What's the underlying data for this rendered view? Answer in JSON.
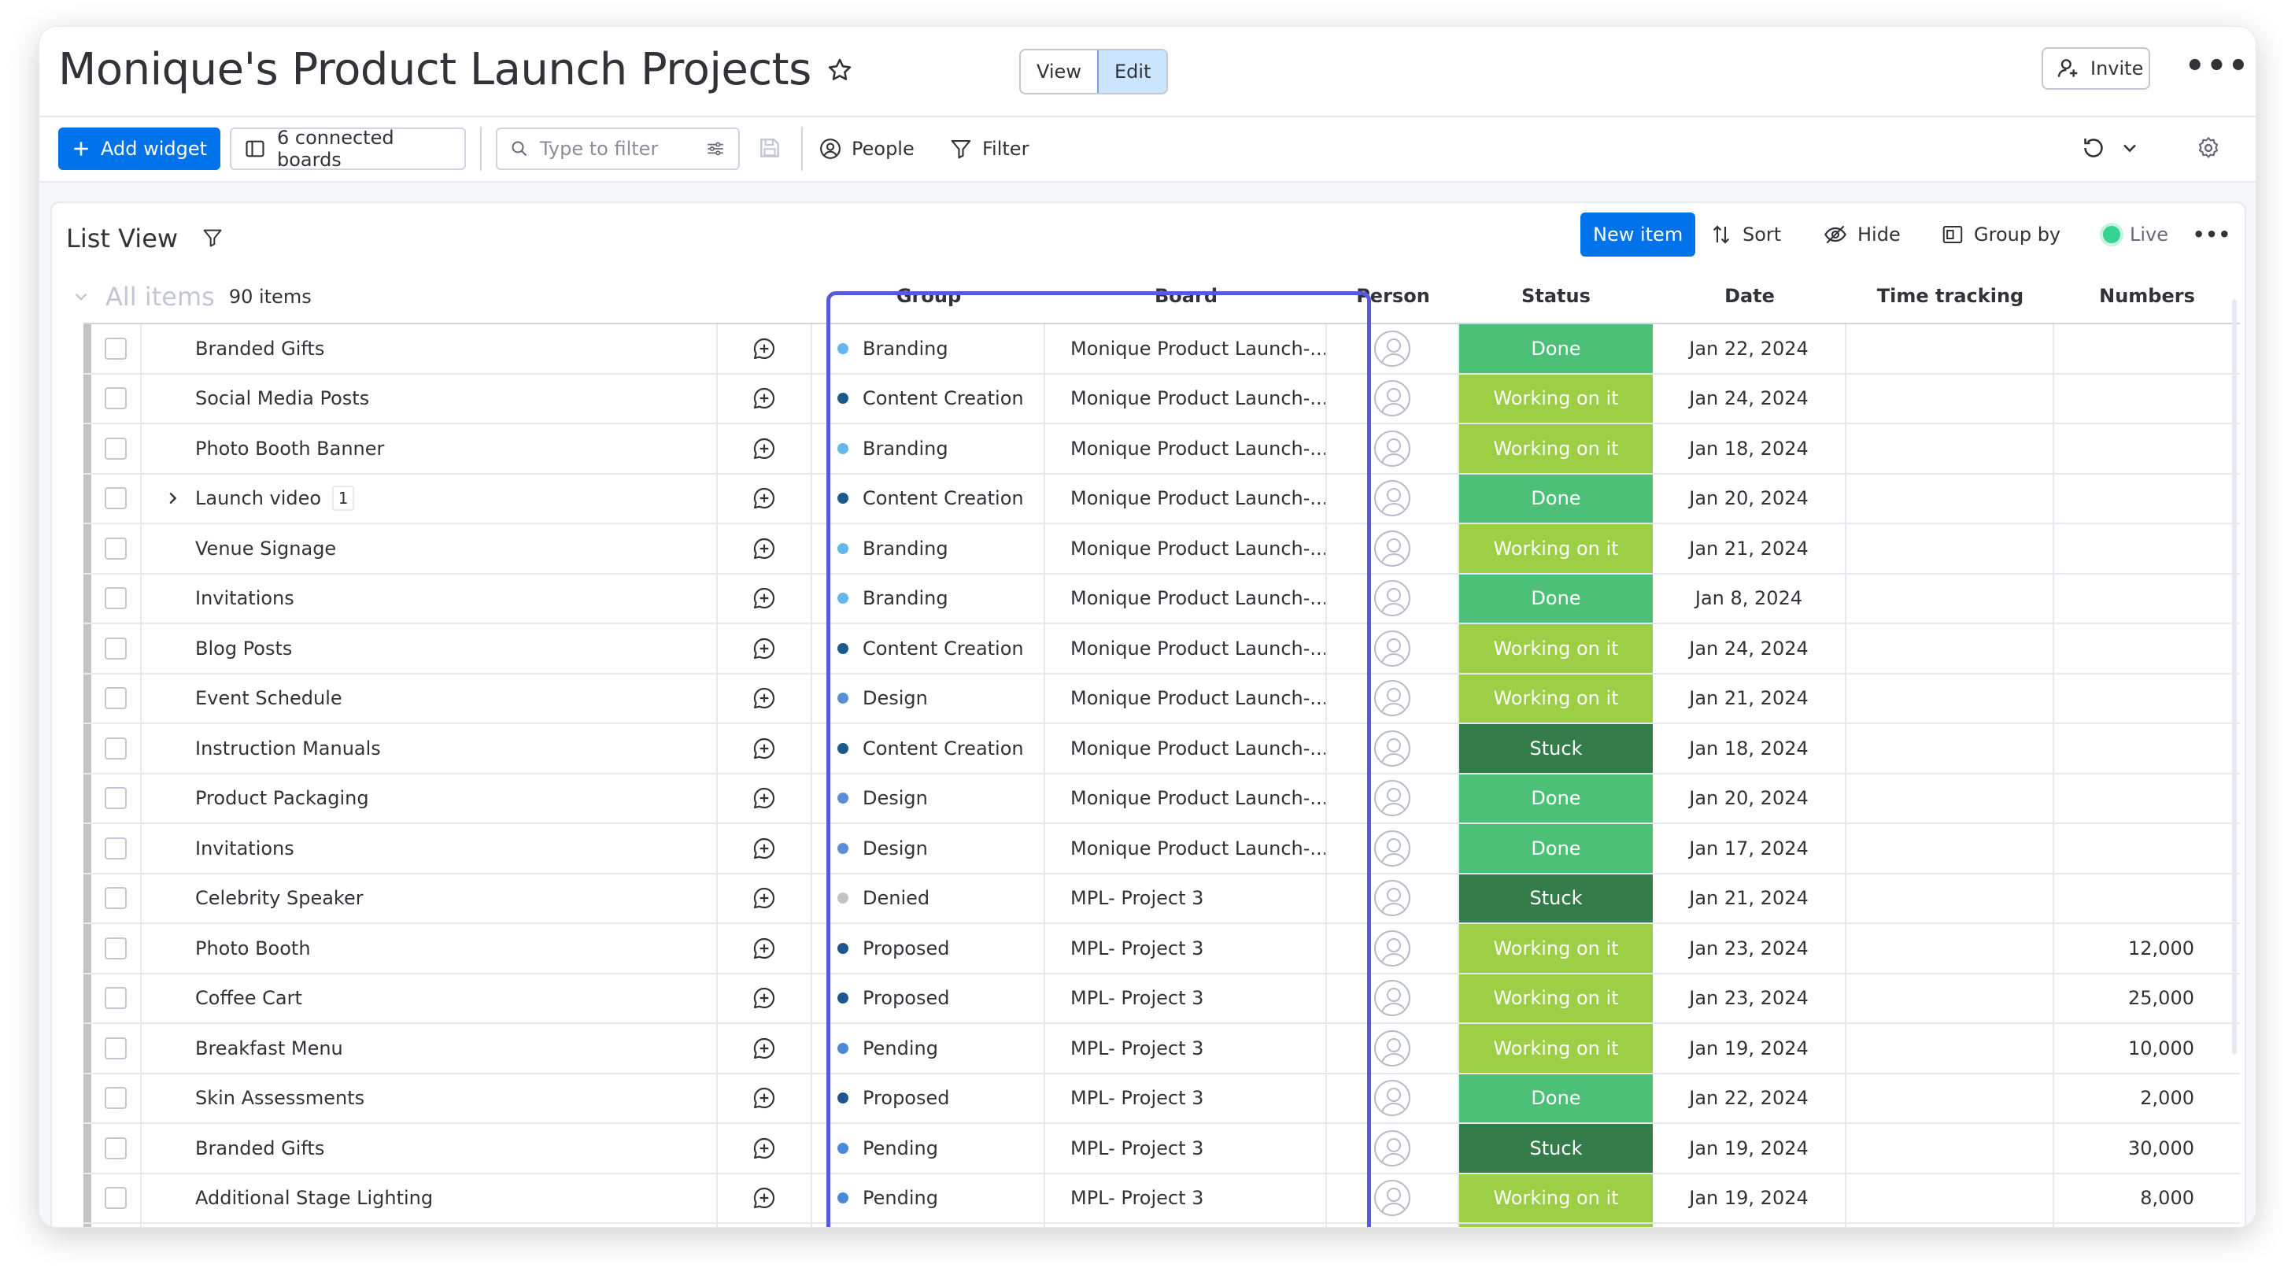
{
  "header": {
    "title": "Monique's Product Launch Projects",
    "view_label": "View",
    "edit_label": "Edit",
    "invite_label": "Invite"
  },
  "toolbar": {
    "add_widget_label": "Add widget",
    "connected_boards_label": "6 connected boards",
    "filter_placeholder": "Type to filter",
    "people_label": "People",
    "filter_label": "Filter"
  },
  "list_view": {
    "title": "List View",
    "new_item_label": "New item",
    "sort_label": "Sort",
    "hide_label": "Hide",
    "group_by_label": "Group by",
    "live_label": "Live",
    "all_items_label": "All items",
    "items_count": "90 items"
  },
  "columns": {
    "group": "Group",
    "board": "Board",
    "person": "Person",
    "status": "Status",
    "date": "Date",
    "time_tracking": "Time tracking",
    "numbers": "Numbers"
  },
  "colors": {
    "accent": "#0073ea",
    "highlight": "#5959e0",
    "status_done": "#4cc076",
    "status_working": "#9ccf45",
    "status_stuck": "#347d4a",
    "group_branding": "#66b8ec",
    "group_content_creation": "#1d5a8c",
    "group_design": "#5a8fd8",
    "group_denied": "#c4c4c4",
    "group_proposed": "#1e5790",
    "group_pending": "#4b89dc"
  },
  "rows": [
    {
      "name": "Branded Gifts",
      "group": "Branding",
      "group_color": "#66b8ec",
      "board": "Monique Product Launch-...",
      "status": "Done",
      "status_color": "#4cc076",
      "date": "Jan 22, 2024",
      "number": ""
    },
    {
      "name": "Social Media Posts",
      "group": "Content Creation",
      "group_color": "#1d5a8c",
      "board": "Monique Product Launch-...",
      "status": "Working on it",
      "status_color": "#9ccf45",
      "date": "Jan 24, 2024",
      "number": ""
    },
    {
      "name": "Photo Booth Banner",
      "group": "Branding",
      "group_color": "#66b8ec",
      "board": "Monique Product Launch-...",
      "status": "Working on it",
      "status_color": "#9ccf45",
      "date": "Jan 18, 2024",
      "number": ""
    },
    {
      "name": "Launch video",
      "subitems": "1",
      "group": "Content Creation",
      "group_color": "#1d5a8c",
      "board": "Monique Product Launch-...",
      "status": "Done",
      "status_color": "#4cc076",
      "date": "Jan 20, 2024",
      "number": ""
    },
    {
      "name": "Venue Signage",
      "group": "Branding",
      "group_color": "#66b8ec",
      "board": "Monique Product Launch-...",
      "status": "Working on it",
      "status_color": "#9ccf45",
      "date": "Jan 21, 2024",
      "number": ""
    },
    {
      "name": "Invitations",
      "group": "Branding",
      "group_color": "#66b8ec",
      "board": "Monique Product Launch-...",
      "status": "Done",
      "status_color": "#4cc076",
      "date": "Jan 8, 2024",
      "number": ""
    },
    {
      "name": "Blog Posts",
      "group": "Content Creation",
      "group_color": "#1d5a8c",
      "board": "Monique Product Launch-...",
      "status": "Working on it",
      "status_color": "#9ccf45",
      "date": "Jan 24, 2024",
      "number": ""
    },
    {
      "name": "Event Schedule",
      "group": "Design",
      "group_color": "#5a8fd8",
      "board": "Monique Product Launch-...",
      "status": "Working on it",
      "status_color": "#9ccf45",
      "date": "Jan 21, 2024",
      "number": ""
    },
    {
      "name": "Instruction Manuals",
      "group": "Content Creation",
      "group_color": "#1d5a8c",
      "board": "Monique Product Launch-...",
      "status": "Stuck",
      "status_color": "#347d4a",
      "date": "Jan 18, 2024",
      "number": ""
    },
    {
      "name": "Product Packaging",
      "group": "Design",
      "group_color": "#5a8fd8",
      "board": "Monique Product Launch-...",
      "status": "Done",
      "status_color": "#4cc076",
      "date": "Jan 20, 2024",
      "number": ""
    },
    {
      "name": "Invitations",
      "group": "Design",
      "group_color": "#5a8fd8",
      "board": "Monique Product Launch-...",
      "status": "Done",
      "status_color": "#4cc076",
      "date": "Jan 17, 2024",
      "number": ""
    },
    {
      "name": "Celebrity Speaker",
      "group": "Denied",
      "group_color": "#c4c4c4",
      "board": "MPL- Project 3",
      "status": "Stuck",
      "status_color": "#347d4a",
      "date": "Jan 21, 2024",
      "number": ""
    },
    {
      "name": "Photo Booth",
      "group": "Proposed",
      "group_color": "#1e5790",
      "board": "MPL- Project 3",
      "status": "Working on it",
      "status_color": "#9ccf45",
      "date": "Jan 23, 2024",
      "number": "12,000"
    },
    {
      "name": "Coffee Cart",
      "group": "Proposed",
      "group_color": "#1e5790",
      "board": "MPL- Project 3",
      "status": "Working on it",
      "status_color": "#9ccf45",
      "date": "Jan 23, 2024",
      "number": "25,000"
    },
    {
      "name": "Breakfast Menu",
      "group": "Pending",
      "group_color": "#4b89dc",
      "board": "MPL- Project 3",
      "status": "Working on it",
      "status_color": "#9ccf45",
      "date": "Jan 19, 2024",
      "number": "10,000"
    },
    {
      "name": "Skin Assessments",
      "group": "Proposed",
      "group_color": "#1e5790",
      "board": "MPL- Project 3",
      "status": "Done",
      "status_color": "#4cc076",
      "date": "Jan 22, 2024",
      "number": "2,000"
    },
    {
      "name": "Branded Gifts",
      "group": "Pending",
      "group_color": "#4b89dc",
      "board": "MPL- Project 3",
      "status": "Stuck",
      "status_color": "#347d4a",
      "date": "Jan 19, 2024",
      "number": "30,000"
    },
    {
      "name": "Additional Stage Lighting",
      "group": "Pending",
      "group_color": "#4b89dc",
      "board": "MPL- Project 3",
      "status": "Working on it",
      "status_color": "#9ccf45",
      "date": "Jan 19, 2024",
      "number": "8,000"
    },
    {
      "name": "",
      "group": "",
      "group_color": "#c4c4c4",
      "board": "",
      "status": "",
      "status_color": "#9ccf45",
      "date": "",
      "number": ""
    }
  ]
}
